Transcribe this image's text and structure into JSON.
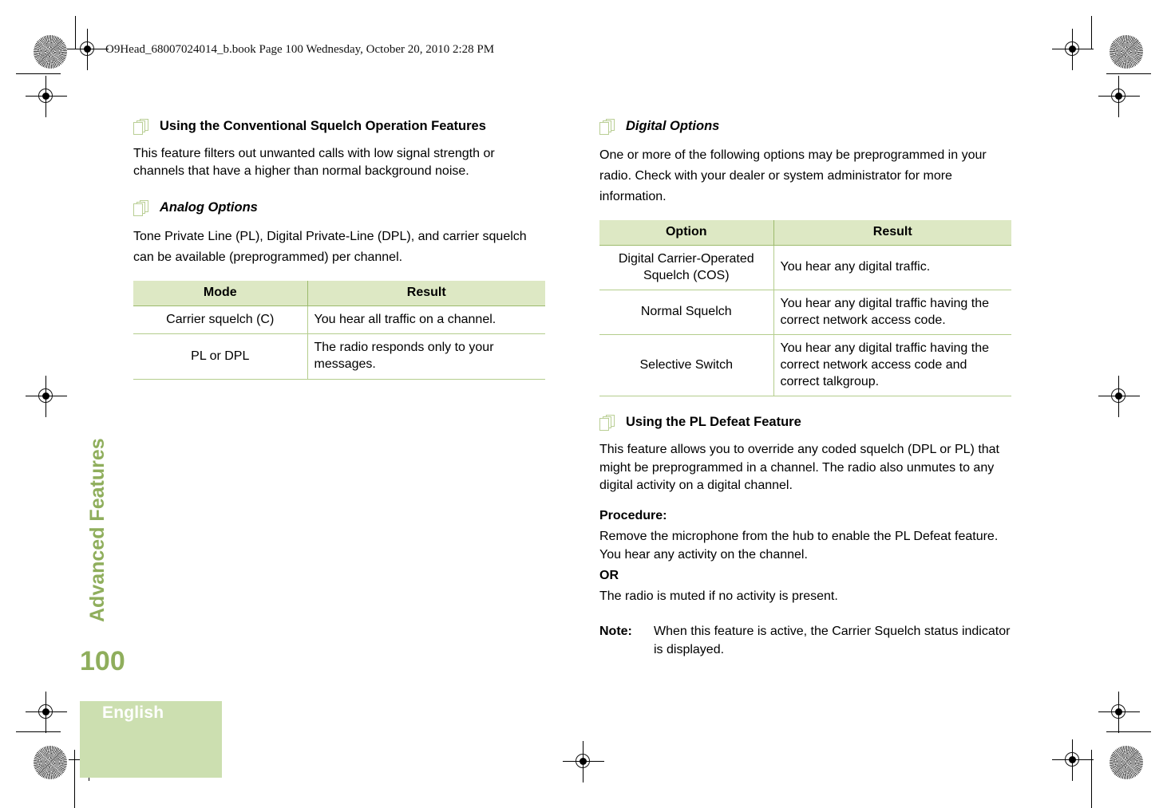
{
  "document": {
    "file_header": "O9Head_68007024014_b.book  Page 100  Wednesday, October 20, 2010  2:28 PM",
    "chapter_title": "Advanced Features",
    "page_number": "100",
    "language_label": "English",
    "colors": {
      "accent_green": "#8fae5c",
      "tab_green": "#ccdfb0",
      "table_header_green": "#dde8c4",
      "table_rule_green": "#b4cd8c",
      "icon_green": "#b9ce94"
    }
  },
  "left_column": {
    "section1": {
      "heading": "Using the Conventional Squelch Operation Features",
      "paragraph": "This feature filters out unwanted calls with low signal strength or channels that have a higher than normal background noise."
    },
    "section2": {
      "heading": "Analog Options",
      "paragraph": "Tone Private Line (PL), Digital Private-Line (DPL), and carrier squelch can be available (preprogrammed) per channel.",
      "table": {
        "headers": [
          "Mode",
          "Result"
        ],
        "rows": [
          [
            "Carrier squelch (C)",
            "You hear all traffic on a channel."
          ],
          [
            "PL or DPL",
            "The radio responds only to your messages."
          ]
        ]
      }
    }
  },
  "right_column": {
    "section1": {
      "heading": "Digital Options",
      "paragraph": "One or more of the following options may be preprogrammed in your radio. Check with your dealer or system administrator for more information.",
      "table": {
        "headers": [
          "Option",
          "Result"
        ],
        "rows": [
          [
            "Digital Carrier-Operated Squelch (COS)",
            "You hear any digital traffic."
          ],
          [
            "Normal Squelch",
            "You hear any digital traffic having the correct network access code."
          ],
          [
            "Selective Switch",
            "You hear any digital traffic having the correct network access code and correct talkgroup."
          ]
        ]
      }
    },
    "section2": {
      "heading": "Using the PL Defeat Feature",
      "paragraph": "This feature allows you to override any coded squelch (DPL or PL) that might be preprogrammed in a channel. The radio also unmutes to any digital activity on a digital channel.",
      "procedure_label": "Procedure:",
      "procedure_step": "Remove the microphone from the hub to enable the PL Defeat feature. You hear any activity on the channel.",
      "or_label": "OR",
      "alternative": "The radio is muted if no activity is present.",
      "note_label": "Note:",
      "note_text": "When this feature is active, the Carrier Squelch status indicator is displayed."
    }
  }
}
